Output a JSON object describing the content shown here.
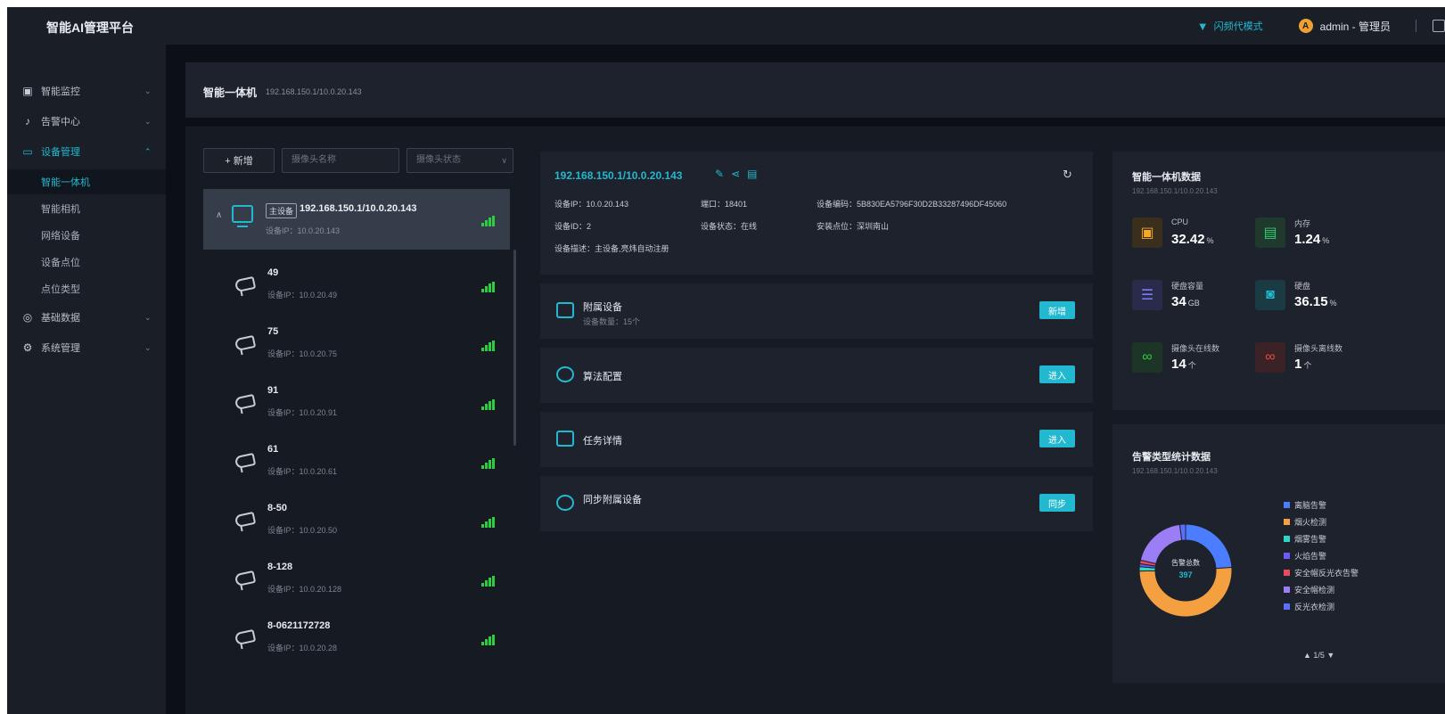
{
  "app": {
    "title": "智能AI管理平台"
  },
  "header": {
    "mode_label": "闪频代模式",
    "user_initial": "A",
    "user_label": "admin - 管理员"
  },
  "sidebar": {
    "items": [
      {
        "label": "智能监控",
        "chevron": "⌄"
      },
      {
        "label": "告警中心",
        "chevron": "⌄"
      },
      {
        "label": "设备管理",
        "chevron": "⌃"
      },
      {
        "label": "基础数据",
        "chevron": "⌄"
      },
      {
        "label": "系统管理",
        "chevron": "⌄"
      }
    ],
    "sub_items": [
      {
        "label": "智能一体机"
      },
      {
        "label": "智能相机"
      },
      {
        "label": "网络设备"
      },
      {
        "label": "设备点位"
      },
      {
        "label": "点位类型"
      }
    ]
  },
  "breadcrumb": {
    "title": "智能一体机",
    "subtitle": "192.168.150.1/10.0.20.143"
  },
  "device_list": {
    "new_button": "+ 新增",
    "name_placeholder": "摄像头名称",
    "status_placeholder": "摄像头状态",
    "main_device": {
      "tag": "主设备",
      "name": "192.168.150.1/10.0.20.143",
      "ip": "设备IP：10.0.20.143"
    },
    "cameras": [
      {
        "name": "49",
        "ip": "设备IP：10.0.20.49"
      },
      {
        "name": "75",
        "ip": "设备IP：10.0.20.75"
      },
      {
        "name": "91",
        "ip": "设备IP：10.0.20.91"
      },
      {
        "name": "61",
        "ip": "设备IP：10.0.20.61"
      },
      {
        "name": "8-50",
        "ip": "设备IP：10.0.20.50"
      },
      {
        "name": "8-128",
        "ip": "设备IP：10.0.20.128"
      },
      {
        "name": "8-0621172728",
        "ip": "设备IP：10.0.20.28"
      }
    ]
  },
  "device_info": {
    "ip": "192.168.150.1/10.0.20.143",
    "device_ip": "设备IP：10.0.20.143",
    "device_id": "设备ID：2",
    "device_desc": "设备描述：主设备,亮炜自动注册",
    "port": "端口：18401",
    "status": "设备状态：在线",
    "code": "设备编码：5B830EA5796F30D2B33287496DF45060",
    "location": "安装点位：深圳南山"
  },
  "actions": [
    {
      "title": "附属设备",
      "sub": "设备数量：15个",
      "button": "新增",
      "icon": "monitor-icon"
    },
    {
      "title": "算法配置",
      "sub": "",
      "button": "进入",
      "icon": "algorithm-icon"
    },
    {
      "title": "任务详情",
      "sub": "",
      "button": "进入",
      "icon": "task-list-icon"
    },
    {
      "title": "同步附属设备",
      "sub": "",
      "button": "同步",
      "icon": "sync-icon"
    }
  ],
  "stats": {
    "title": "智能一体机数据",
    "subtitle": "192.168.150.1/10.0.20.143",
    "metrics": [
      {
        "label": "CPU",
        "value": "32.42",
        "unit": "%",
        "icon": "cpu-icon",
        "color": "#f5a623"
      },
      {
        "label": "内存",
        "value": "1.24",
        "unit": "%",
        "icon": "memory-icon",
        "color": "#2ecc71"
      },
      {
        "label": "硬盘容量",
        "value": "34",
        "unit": "GB",
        "icon": "disk-capacity-icon",
        "color": "#7b7cf5"
      },
      {
        "label": "硬盘",
        "value": "36.15",
        "unit": "%",
        "icon": "disk-icon",
        "color": "#22b8cf"
      },
      {
        "label": "摄像头在线数",
        "value": "14",
        "unit": "个",
        "icon": "link-online-icon",
        "color": "#2ecc40"
      },
      {
        "label": "摄像头离线数",
        "value": "1",
        "unit": "个",
        "icon": "link-offline-icon",
        "color": "#e74c3c"
      }
    ]
  },
  "alarm": {
    "title": "告警类型统计数据",
    "subtitle": "192.168.150.1/10.0.20.143",
    "center_label": "告警总数",
    "center_value": "397",
    "pager": "▲ 1/5 ▼",
    "legend": [
      {
        "name": "离脑告警",
        "color": "#4a7dff"
      },
      {
        "name": "烟火检测",
        "color": "#f5a040"
      },
      {
        "name": "烟雾告警",
        "color": "#2ed6c8"
      },
      {
        "name": "火焰告警",
        "color": "#6b5bff"
      },
      {
        "name": "安全帽反光衣告警",
        "color": "#e84a5f"
      },
      {
        "name": "安全帽检测",
        "color": "#9b7ef5"
      },
      {
        "name": "反光衣检测",
        "color": "#5b6fff"
      }
    ]
  },
  "chart_data": {
    "type": "pie",
    "title": "告警类型统计数据",
    "categories": [
      "离脑告警",
      "烟火检测",
      "烟雾告警",
      "火焰告警",
      "安全帽反光衣告警",
      "安全帽检测",
      "反光衣检测"
    ],
    "values": [
      95,
      202,
      6,
      4,
      5,
      77,
      8
    ],
    "total": 397
  }
}
